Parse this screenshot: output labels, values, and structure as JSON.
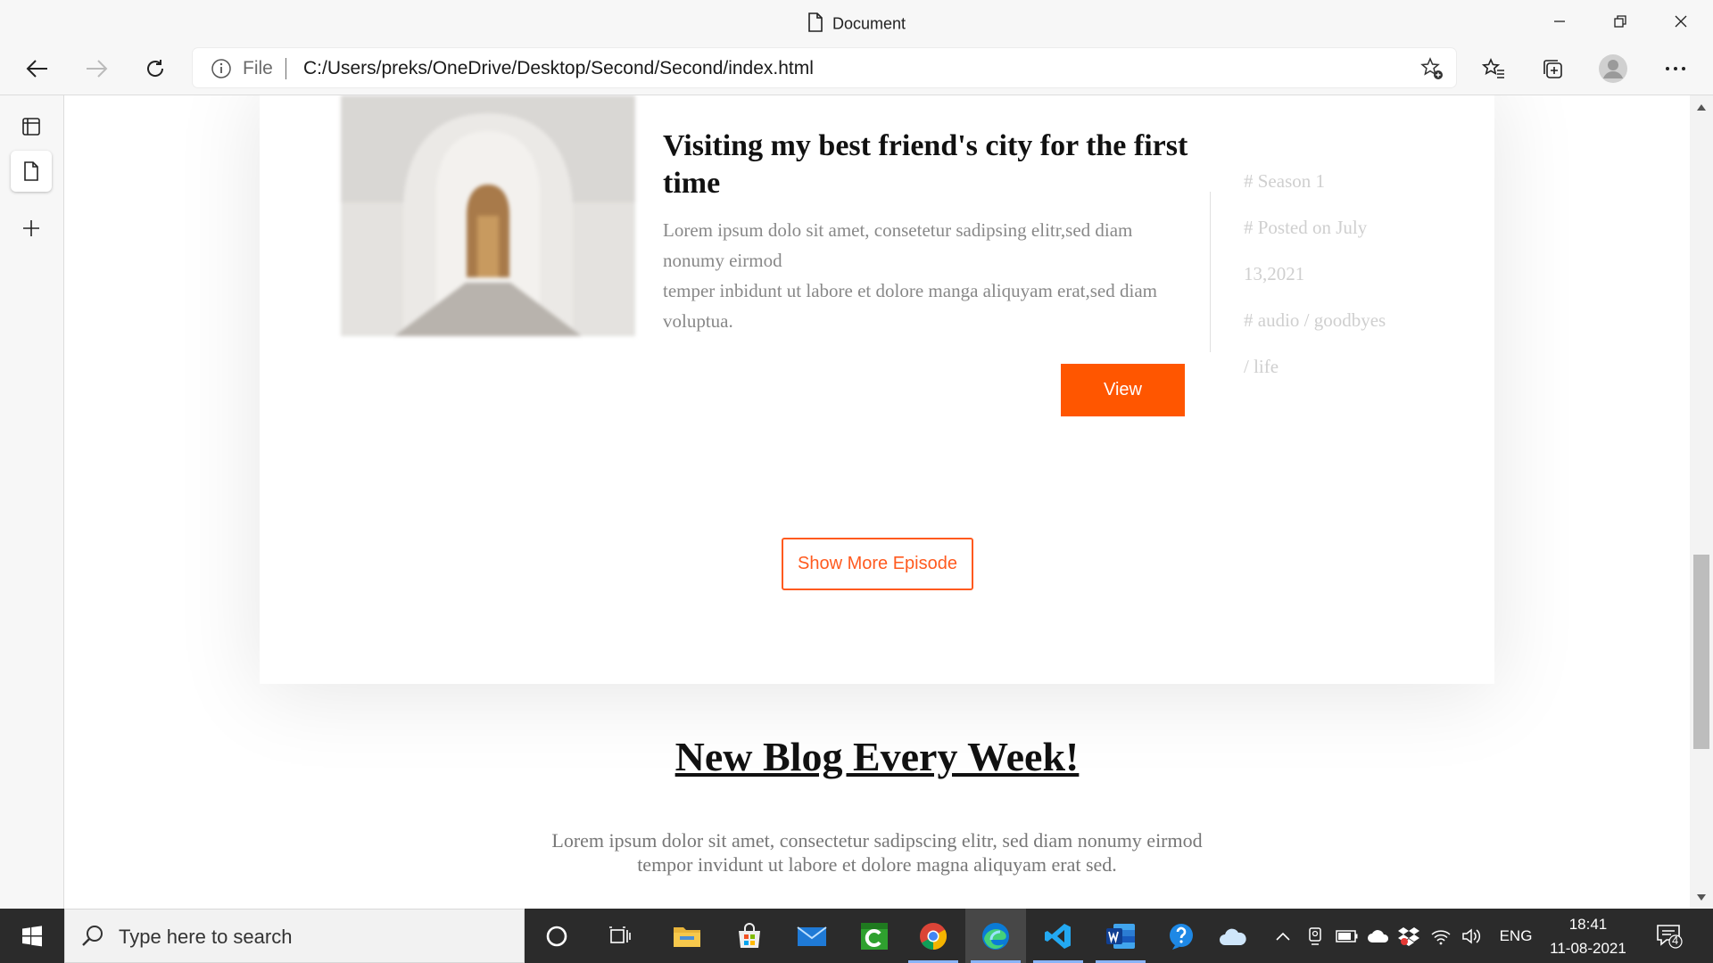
{
  "window": {
    "title": "Document"
  },
  "address_bar": {
    "scheme_label": "File",
    "url": "C:/Users/preks/OneDrive/Desktop/Second/Second/index.html"
  },
  "episode": {
    "title": "Visiting my best friend's city for the first time",
    "body_line1": "Lorem ipsum dolo sit amet, consetetur sadipsing elitr,sed diam nonumy eirmod",
    "body_line2": "temper inbidunt ut labore et dolore manga aliquyam erat,sed diam voluptua.",
    "meta": [
      "# Season 1",
      "# Posted on July",
      "13,2021",
      "# audio / goodbyes",
      "/ life"
    ],
    "view_label": "View"
  },
  "show_more_label": "Show More Episode",
  "blog": {
    "heading": "New Blog Every Week!",
    "text": "Lorem ipsum dolor sit amet, consectetur sadipscing elitr, sed diam nonumy eirmod tempor invidunt ut labore et dolore magna aliquyam erat sed."
  },
  "taskbar": {
    "search_placeholder": "Type here to search",
    "language": "ENG",
    "time": "18:41",
    "date": "11-08-2021",
    "notification_count": "4"
  },
  "colors": {
    "accent": "#ff5600",
    "taskbar": "#2b2b2b"
  },
  "icons": [
    "document-icon",
    "back-icon",
    "forward-icon",
    "refresh-icon",
    "info-icon",
    "add-favorite-icon",
    "favorites-icon",
    "collections-icon",
    "profile-icon",
    "more-icon",
    "tab-actions-icon",
    "page-tab-icon",
    "new-tab-icon",
    "windows-start-icon",
    "search-icon",
    "cortana-icon",
    "task-view-icon",
    "file-explorer-icon",
    "store-icon",
    "mail-icon",
    "utorrent-icon",
    "chrome-icon",
    "edge-icon",
    "vscode-icon",
    "word-icon",
    "help-icon",
    "weather-icon"
  ]
}
